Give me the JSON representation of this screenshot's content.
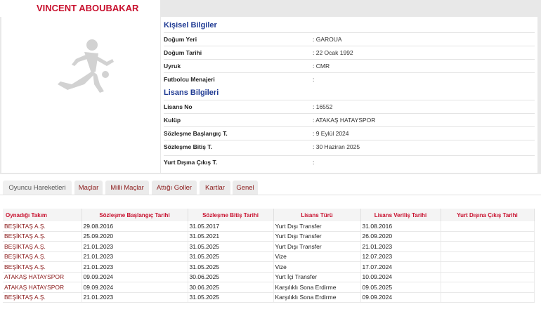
{
  "player": {
    "name": "VINCENT ABOUBAKAR"
  },
  "personal": {
    "title": "Kişisel Bilgiler",
    "rows": [
      {
        "label": "Doğum Yeri",
        "value": ": GAROUA"
      },
      {
        "label": "Doğum Tarihi",
        "value": ": 22 Ocak 1992"
      },
      {
        "label": "Uyruk",
        "value": ": CMR"
      },
      {
        "label": "Futbolcu Menajeri",
        "value": ":"
      }
    ]
  },
  "license": {
    "title": "Lisans Bilgileri",
    "rows": [
      {
        "label": "Lisans No",
        "value": ": 16552"
      },
      {
        "label": "Kulüp",
        "value": ": ATAKAŞ HATAYSPOR"
      },
      {
        "label": "Sözleşme Başlangıç T.",
        "value": ": 9 Eylül 2024"
      },
      {
        "label": "Sözleşme Bitiş T.",
        "value": ": 30 Haziran 2025"
      },
      {
        "label": "Yurt Dışına Çıkış T.",
        "value": ":"
      }
    ]
  },
  "tabs": [
    "Oyuncu Hareketleri",
    "Maçlar",
    "Milli Maçlar",
    "Attığı Goller",
    "Kartlar",
    "Genel"
  ],
  "table": {
    "headers": [
      "Oynadığı Takım",
      "Sözleşme Başlangıç Tarihi",
      "Sözleşme Bitiş Tarihi",
      "Lisans Türü",
      "Lisans Veriliş Tarihi",
      "Yurt Dışına Çıkış Tarihi"
    ],
    "rows": [
      [
        "BEŞİKTAŞ A.Ş.",
        "29.08.2016",
        "31.05.2017",
        "Yurt Dışı Transfer",
        "31.08.2016",
        ""
      ],
      [
        "BEŞİKTAŞ A.Ş.",
        "25.09.2020",
        "31.05.2021",
        "Yurt Dışı Transfer",
        "26.09.2020",
        ""
      ],
      [
        "BEŞİKTAŞ A.Ş.",
        "21.01.2023",
        "31.05.2025",
        "Yurt Dışı Transfer",
        "21.01.2023",
        ""
      ],
      [
        "BEŞİKTAŞ A.Ş.",
        "21.01.2023",
        "31.05.2025",
        "Vize",
        "12.07.2023",
        ""
      ],
      [
        "BEŞİKTAŞ A.Ş.",
        "21.01.2023",
        "31.05.2025",
        "Vize",
        "17.07.2024",
        ""
      ],
      [
        "ATAKAŞ HATAYSPOR",
        "09.09.2024",
        "30.06.2025",
        "Yurt İçi Transfer",
        "10.09.2024",
        ""
      ],
      [
        "ATAKAŞ HATAYSPOR",
        "09.09.2024",
        "30.06.2025",
        "Karşılıklı Sona Erdirme",
        "09.05.2025",
        ""
      ],
      [
        "BEŞİKTAŞ A.Ş.",
        "21.01.2023",
        "31.05.2025",
        "Karşılıklı Sona Erdirme",
        "09.09.2024",
        ""
      ]
    ]
  }
}
